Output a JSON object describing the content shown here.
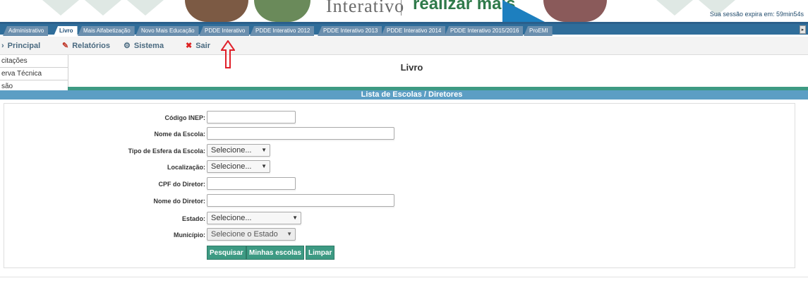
{
  "header": {
    "logo_text": "Interativo",
    "logo_slogan": "realizar mais",
    "session_text": "Sua sessão expira em: 59min54s"
  },
  "tabs": [
    {
      "label": "Administrativo",
      "active": false
    },
    {
      "label": "Livro",
      "active": true
    },
    {
      "label": "Mais Alfabetização",
      "active": false
    },
    {
      "label": "Novo Mais Educação",
      "active": false
    },
    {
      "label": "PDDE Interativo",
      "active": false
    },
    {
      "label": "PDDE Interativo 2012",
      "active": false
    },
    {
      "label": "PDDE Interativo 2013",
      "active": false
    },
    {
      "label": "PDDE Interativo 2014",
      "active": false
    },
    {
      "label": "PDDE Interativo 2015/2016",
      "active": false
    },
    {
      "label": "ProEMI",
      "active": false
    }
  ],
  "menu": {
    "principal": "Principal",
    "relatorios": "Relatórios",
    "sistema": "Sistema",
    "sair": "Sair"
  },
  "sidebar": {
    "items": [
      "citações",
      "erva Técnica",
      "são"
    ]
  },
  "page": {
    "title": "Livro",
    "section_title": "Lista de Escolas / Diretores"
  },
  "form": {
    "codigo_inep_label": "Código INEP:",
    "nome_escola_label": "Nome da Escola:",
    "tipo_esfera_label": "Tipo de Esfera da Escola:",
    "tipo_esfera_value": "Selecione...",
    "localizacao_label": "Localização:",
    "localizacao_value": "Selecione...",
    "cpf_diretor_label": "CPF do Diretor:",
    "nome_diretor_label": "Nome do Diretor:",
    "estado_label": "Estado:",
    "estado_value": "Selecione...",
    "municipio_label": "Município:",
    "municipio_value": "Selecione o Estado",
    "btn_pesquisar": "Pesquisar",
    "btn_minhas_escolas": "Minhas escolas",
    "btn_limpar": "Limpar"
  },
  "colors": {
    "tab_bar": "#2f6d9a",
    "section_green": "#3d9a83",
    "section_blue": "#5c9ec4",
    "annotation_red": "#e0202a"
  }
}
